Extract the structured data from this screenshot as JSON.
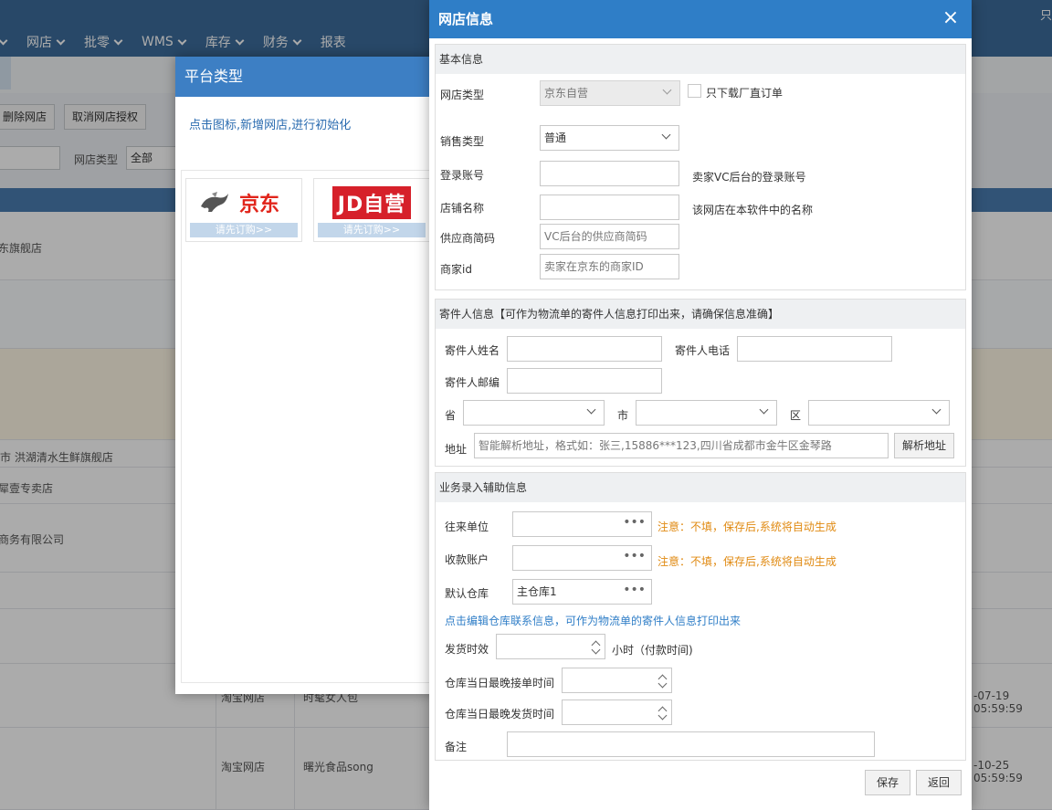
{
  "background": {
    "menu": [
      "网店",
      "批零",
      "WMS",
      "库存",
      "财务",
      "报表"
    ],
    "corner_text": "只",
    "toolbar": {
      "delete_label": "删除网店",
      "cancel_auth_label": "取消网店授权"
    },
    "filter": {
      "shop_type_label": "网店类型",
      "shop_type_value": "全部"
    },
    "rows": [
      {
        "name": "东旗舰店"
      },
      {
        "name": "市 洪湖清水生鲜旗舰店"
      },
      {
        "name": "犀壹专卖店"
      },
      {
        "name": "商务有限公司"
      },
      {
        "type": "淘宝网店",
        "name": "时髦女人包",
        "time": "-07-19 05:59:59"
      },
      {
        "type": "淘宝网店",
        "name": "曙光食品song",
        "time": "-10-25 05:59:59"
      }
    ]
  },
  "platform_dialog": {
    "title": "平台类型",
    "hint": "点击图标,新增网店,进行初始化",
    "cards": [
      {
        "logo_text": "京东",
        "sub_label": "请先订购>>",
        "logo_color": "#e1251b"
      },
      {
        "logo_text": "JD自营",
        "sub_label": "请先订购>>",
        "logo_color": "#d6202a"
      }
    ]
  },
  "dialog": {
    "title": "网店信息",
    "close_icon": "×",
    "basic": {
      "header": "基本信息",
      "shop_type_label": "网店类型",
      "shop_type_value": "京东自营",
      "only_factory_label": "只下载厂直订单",
      "sale_type_label": "销售类型",
      "sale_type_value": "普通",
      "login_label": "登录账号",
      "login_value": "",
      "login_hint": "卖家VC后台的登录账号",
      "store_name_label": "店铺名称",
      "store_name_value": "",
      "store_name_hint": "该网店在本软件中的名称",
      "supplier_label": "供应商简码",
      "supplier_placeholder": "VC后台的供应商简码",
      "merchant_label": "商家id",
      "merchant_placeholder": "卖家在京东的商家ID"
    },
    "sender": {
      "header": "寄件人信息【可作为物流单的寄件人信息打印出来，请确保信息准确】",
      "name_label": "寄件人姓名",
      "phone_label": "寄件人电话",
      "postcode_label": "寄件人邮编",
      "province_label": "省",
      "city_label": "市",
      "district_label": "区",
      "address_label": "地址",
      "address_placeholder": "智能解析地址，格式如：张三,15886***123,四川省成都市金牛区金琴路",
      "parse_button": "解析地址"
    },
    "business": {
      "header": "业务录入辅助信息",
      "partner_label": "往来单位",
      "partner_note": "注意：不填，保存后,系统将自动生成",
      "account_label": "收款账户",
      "account_note": "注意：不填，保存后,系统将自动生成",
      "warehouse_label": "默认仓库",
      "warehouse_value": "主仓库1",
      "edit_link": "点击编辑仓库联系信息，可作为物流单的寄件人信息打印出来",
      "ship_time_label": "发货时效",
      "ship_time_unit": "小时（付款时间)",
      "latest_order_label": "仓库当日最晚接单时间",
      "latest_ship_label": "仓库当日最晚发货时间",
      "remark_label": "备注"
    },
    "save_button": "保存",
    "back_button": "返回"
  },
  "colors": {
    "accent": "#2f7ec7",
    "warning": "#e08a12",
    "nav": "#3c6c9c"
  }
}
